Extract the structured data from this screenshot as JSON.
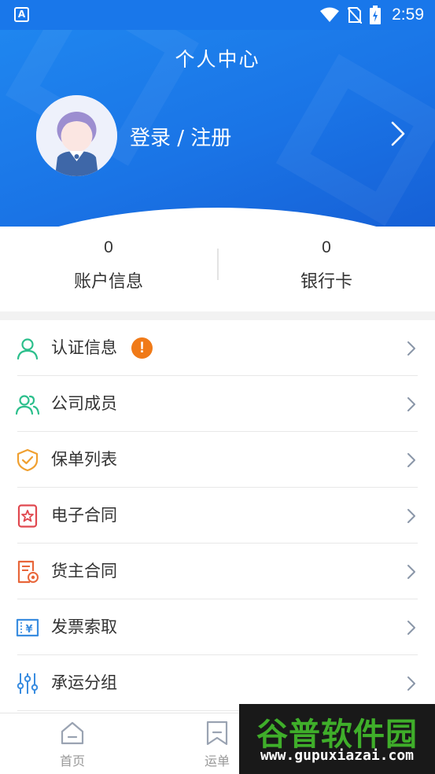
{
  "status_bar": {
    "time": "2:59",
    "app_icon_glyph": "A"
  },
  "header": {
    "title": "个人中心",
    "login_text": "登录 / 注册"
  },
  "stats": [
    {
      "value": "0",
      "label": "账户信息"
    },
    {
      "value": "0",
      "label": "银行卡"
    }
  ],
  "menu": [
    {
      "label": "认证信息",
      "icon": "person-icon",
      "badge": "!"
    },
    {
      "label": "公司成员",
      "icon": "people-icon"
    },
    {
      "label": "保单列表",
      "icon": "shield-check-icon"
    },
    {
      "label": "电子合同",
      "icon": "star-document-icon"
    },
    {
      "label": "货主合同",
      "icon": "document-seal-icon"
    },
    {
      "label": "发票索取",
      "icon": "invoice-ticket-icon"
    },
    {
      "label": "承运分组",
      "icon": "sliders-icon"
    }
  ],
  "bottom_nav": [
    {
      "label": "首页",
      "icon": "home-icon"
    },
    {
      "label": "运单",
      "icon": "bookmark-icon"
    }
  ],
  "watermark": {
    "title": "谷普软件园",
    "url": "www.gupuxiazai.com"
  },
  "colors": {
    "primary": "#1a74e6",
    "text": "#333333",
    "badge": "#f07a18",
    "green_icon": "#2cbf8c",
    "orange_icon": "#f0a030",
    "red_icon": "#e0484f",
    "blue_icon": "#3a8de0"
  }
}
